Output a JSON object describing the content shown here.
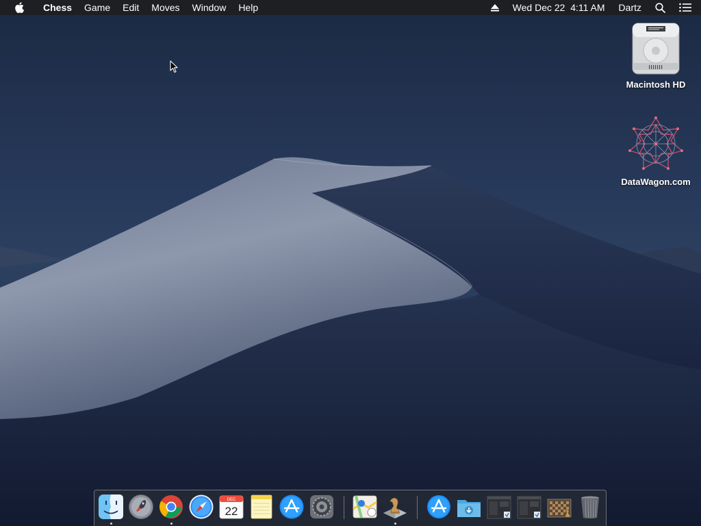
{
  "menubar": {
    "apple_icon": "apple-logo-icon",
    "app_name": "Chess",
    "menus": [
      "Game",
      "Edit",
      "Moves",
      "Window",
      "Help"
    ],
    "status": {
      "eject_icon": "eject-icon",
      "datetime": "Wed Dec 22  4:11 AM",
      "user": "Dartz",
      "search_icon": "spotlight-search-icon",
      "notifications_icon": "notification-center-icon"
    }
  },
  "desktop_icons": [
    {
      "label": "Macintosh HD",
      "icon": "hard-drive-icon"
    },
    {
      "label": "DataWagon.com",
      "icon": "network-share-icon"
    }
  ],
  "dock": {
    "apps": [
      {
        "name": "Finder",
        "icon": "finder-icon",
        "running": true
      },
      {
        "name": "Launchpad",
        "icon": "launchpad-icon",
        "running": false
      },
      {
        "name": "Google Chrome",
        "icon": "chrome-icon",
        "running": true
      },
      {
        "name": "Safari",
        "icon": "safari-icon",
        "running": false
      },
      {
        "name": "Calendar",
        "icon": "calendar-icon",
        "running": false,
        "month": "DEC",
        "day": "22"
      },
      {
        "name": "Notes",
        "icon": "notes-icon",
        "running": false
      },
      {
        "name": "App Store",
        "icon": "app-store-icon",
        "running": false
      },
      {
        "name": "System Preferences",
        "icon": "system-preferences-icon",
        "running": false
      },
      {
        "name": "Maps",
        "icon": "maps-icon",
        "running": false
      },
      {
        "name": "Chess",
        "icon": "chess-icon",
        "running": true
      },
      {
        "name": "App Store Download",
        "icon": "app-store-download-icon",
        "running": false
      },
      {
        "name": "Downloads",
        "icon": "downloads-folder-icon",
        "running": false
      },
      {
        "name": "Screenshot 1",
        "icon": "screenshot-icon",
        "running": false
      },
      {
        "name": "Screenshot 2",
        "icon": "screenshot-icon",
        "running": false
      },
      {
        "name": "Chess Window",
        "icon": "chess-board-window-icon",
        "running": false
      },
      {
        "name": "Trash",
        "icon": "trash-icon",
        "running": false
      }
    ]
  },
  "colors": {
    "menubar_bg": "#1e1e20",
    "wallpaper_sky": "#22344f",
    "dune_light": "#8d97ab",
    "dock_bg": "#282c36"
  }
}
